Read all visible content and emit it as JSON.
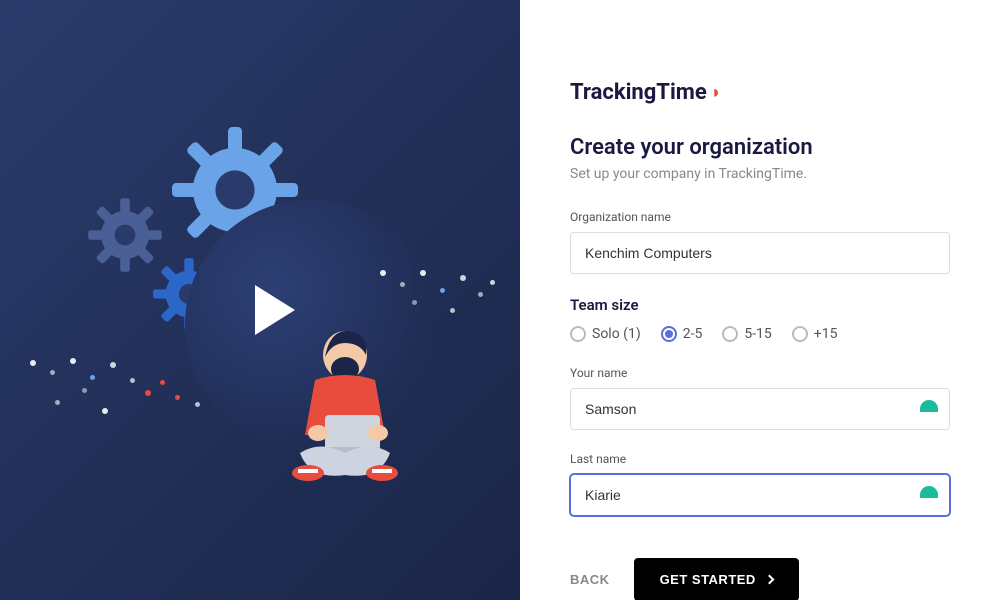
{
  "brand": {
    "name": "TrackingTime"
  },
  "heading": "Create your organization",
  "subheading": "Set up your company in TrackingTime.",
  "fields": {
    "org_label": "Organization name",
    "org_value": "Kenchim Computers",
    "team_label": "Team size",
    "team_options": [
      "Solo (1)",
      "2-5",
      "5-15",
      "+15"
    ],
    "team_selected": "2-5",
    "firstname_label": "Your name",
    "firstname_value": "Samson",
    "lastname_label": "Last name",
    "lastname_value": "Kiarie"
  },
  "actions": {
    "back": "BACK",
    "primary": "GET STARTED"
  }
}
